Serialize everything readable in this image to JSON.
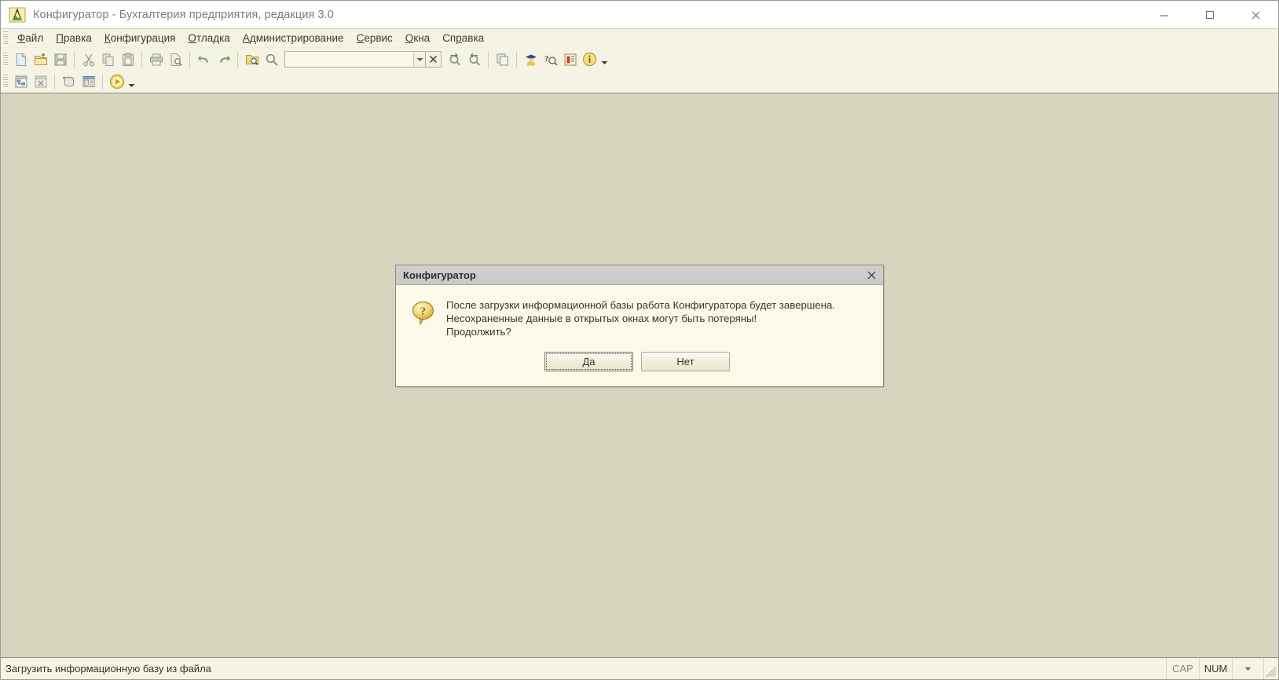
{
  "window": {
    "title": "Конфигуратор - Бухгалтерия предприятия, редакция 3.0",
    "icon": "1c-configurator-icon",
    "controls": {
      "minimize": "minimize-icon",
      "maximize": "maximize-icon",
      "close": "close-icon"
    }
  },
  "menubar": {
    "items": [
      {
        "label": "Файл",
        "accel": "Ф"
      },
      {
        "label": "Правка",
        "accel": "П"
      },
      {
        "label": "Конфигурация",
        "accel": "К"
      },
      {
        "label": "Отладка",
        "accel": "О"
      },
      {
        "label": "Администрирование",
        "accel": "А"
      },
      {
        "label": "Сервис",
        "accel": "С"
      },
      {
        "label": "Окна",
        "accel": "О"
      },
      {
        "label": "Справка",
        "accel": "р"
      }
    ]
  },
  "toolbar_main": {
    "buttons": [
      {
        "name": "new-file-icon",
        "tooltip": "Новый"
      },
      {
        "name": "open-file-icon",
        "tooltip": "Открыть"
      },
      {
        "name": "save-icon",
        "tooltip": "Сохранить"
      },
      {
        "name": "cut-icon",
        "tooltip": "Вырезать"
      },
      {
        "name": "copy-icon",
        "tooltip": "Копировать"
      },
      {
        "name": "paste-icon",
        "tooltip": "Вставить"
      },
      {
        "name": "print-icon",
        "tooltip": "Печать"
      },
      {
        "name": "print-preview-icon",
        "tooltip": "Предварительный просмотр"
      },
      {
        "name": "undo-icon",
        "tooltip": "Отменить"
      },
      {
        "name": "redo-icon",
        "tooltip": "Вернуть"
      },
      {
        "name": "find-in-folder-icon",
        "tooltip": "Глобальный поиск"
      },
      {
        "name": "search-icon",
        "tooltip": "Найти"
      }
    ],
    "search_combo": {
      "value": "",
      "placeholder": ""
    },
    "clear_label": "×",
    "buttons_after": [
      {
        "name": "find-previous-icon",
        "tooltip": "Найти предыдущий"
      },
      {
        "name": "find-next-icon",
        "tooltip": "Найти следующий"
      },
      {
        "name": "windows-icon",
        "tooltip": "Окна"
      },
      {
        "name": "syntax-assistant-icon",
        "tooltip": "Синтакс-помощник"
      },
      {
        "name": "help-search-icon",
        "tooltip": "Поиск в справке"
      },
      {
        "name": "content-icon",
        "tooltip": "Содержание справки"
      },
      {
        "name": "about-info-icon",
        "tooltip": "О программе"
      }
    ],
    "dropdown": "chevron-down-icon"
  },
  "toolbar_second": {
    "buttons": [
      {
        "name": "configuration-tree-icon",
        "tooltip": "Открыть конфигурацию"
      },
      {
        "name": "close-configuration-icon",
        "tooltip": "Закрыть конфигурацию"
      },
      {
        "name": "update-db-config-icon",
        "tooltip": "Обновить конфигурацию базы данных"
      },
      {
        "name": "config-db-icon",
        "tooltip": "Конфигурация базы данных"
      },
      {
        "name": "start-debug-icon",
        "tooltip": "Начать отладку"
      }
    ],
    "dropdown": "chevron-down-icon"
  },
  "dialog": {
    "title": "Конфигуратор",
    "close_label": "×",
    "icon": "question-bubble-icon",
    "message": "После загрузки информационной базы работа Конфигуратора будет завершена.\nНесохраненные данные в открытых окнах могут быть потеряны!\nПродолжить?",
    "buttons": [
      {
        "label": "Да",
        "default": true
      },
      {
        "label": "Нет",
        "default": false
      }
    ]
  },
  "statusbar": {
    "message": "Загрузить информационную базу из файла",
    "indicators": [
      {
        "label": "CAP",
        "active": false
      },
      {
        "label": "NUM",
        "active": true
      }
    ],
    "dropdown": "chevron-down-icon",
    "resize_grip": "resize-grip-icon"
  },
  "colors": {
    "workspace": "#d8d5bf",
    "toolbar": "#f5f3e3",
    "dialog_bg": "#fbf9e8",
    "dialog_title": "#c9c9c6",
    "accent": "#d9a900"
  }
}
